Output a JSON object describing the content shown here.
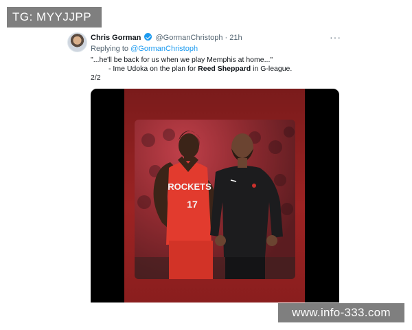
{
  "watermarks": {
    "top_left": "TG: MYYJJPP",
    "bottom_right": "www.info-333.com"
  },
  "tweet": {
    "author_name": "Chris Gorman",
    "handle": "@GormanChristoph",
    "separator": "·",
    "time": "21h",
    "more_label": "···",
    "replying_prefix": "Replying to",
    "replying_to": "@GormanChristoph",
    "quote_line": "\"...he'll be back for us when we play Memphis at home...\"",
    "attribution_prefix": "- Ime Udoka on the plan for ",
    "attribution_name": "Reed Sheppard",
    "attribution_suffix": " in G-league.",
    "thread_count": "2/2"
  },
  "media": {
    "jersey_team": "ROCKETS",
    "jersey_number": "17",
    "colors": {
      "jersey": "#e23b2e",
      "panel": "#9c2323",
      "coach_shirt": "#1c1c1e",
      "verified": "#1d9bf0",
      "link": "#1d9bf0"
    }
  }
}
